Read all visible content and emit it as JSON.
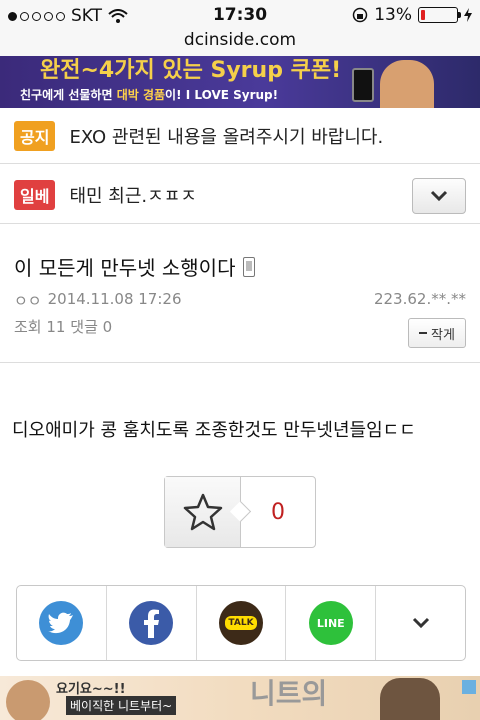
{
  "status": {
    "carrier": "SKT",
    "time": "17:30",
    "battery": "13%",
    "battery_level": 0.13
  },
  "url": "dcinside.com",
  "ad_top": {
    "headline": "완전~4가지 있는 Syrup 쿠폰!",
    "subline_pre": "친구에게 선물하면 ",
    "subline_highlight": "대박 경품",
    "subline_post": "이! I LOVE Syrup!"
  },
  "notice": {
    "badge": "공지",
    "text": "EXO 관련된 내용을 올려주시기 바랍니다."
  },
  "topic": {
    "badge": "일베",
    "title": "태민 최근.ㅈㅍㅈ"
  },
  "post": {
    "title": "이 모든게 만두넷 소행이다",
    "author_marks": "ㅇㅇ",
    "date": "2014.11.08 17:26",
    "ip": "223.62.**.**",
    "views_label": "조회",
    "views": "11",
    "comments_label": "댓글",
    "comments": "0",
    "font_small_label": "작게",
    "body": "디오애미가 콩 훔치도록 조종한것도 만두넷년들임ㄷㄷ",
    "recommend_count": "0"
  },
  "share": {
    "items": [
      "twitter-icon",
      "facebook-icon",
      "kakaotalk-icon",
      "line-icon",
      "chevron-down-icon"
    ],
    "kakao_label": "TALK",
    "line_label": "LINE"
  },
  "ad_bottom": {
    "line1": "요기요~~!!",
    "line2": "베이직한 니트부터~",
    "big": "니트의"
  },
  "colors": {
    "notice_badge": "#f0a020",
    "ilbe_badge": "#e04040",
    "recommend_count": "#c02020"
  }
}
